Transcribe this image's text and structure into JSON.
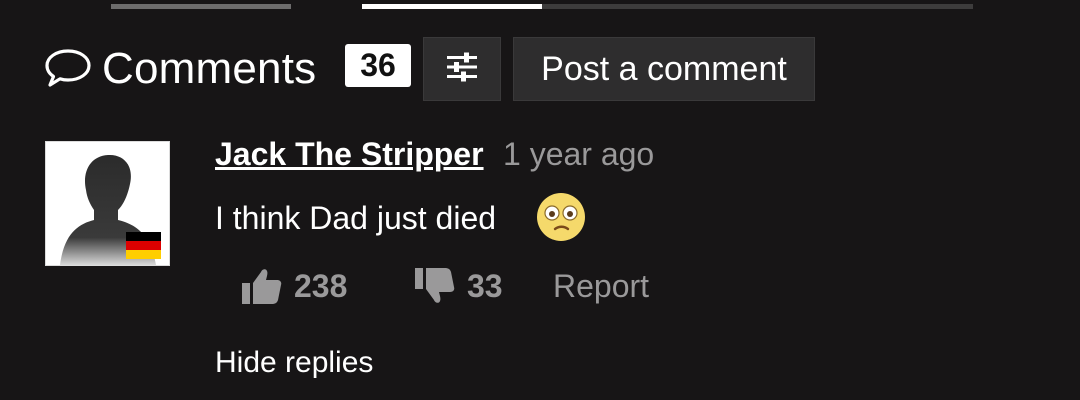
{
  "header": {
    "title": "Comments",
    "count": "36",
    "post_label": "Post a comment",
    "icons": {
      "comments": "speech-bubble-icon",
      "filter": "sliders-icon"
    }
  },
  "comment": {
    "author": "Jack The Stripper",
    "time": "1 year ago",
    "text": "I think Dad just died",
    "emoji": "flushed-face",
    "flag": "germany",
    "likes": "238",
    "dislikes": "33",
    "report_label": "Report",
    "hide_replies_label": "Hide replies"
  },
  "colors": {
    "background": "#171516",
    "button_bg": "#2e2d2e",
    "muted_text": "#9a999a",
    "flag_black": "#000000",
    "flag_red": "#dd0000",
    "flag_gold": "#ffce00"
  }
}
